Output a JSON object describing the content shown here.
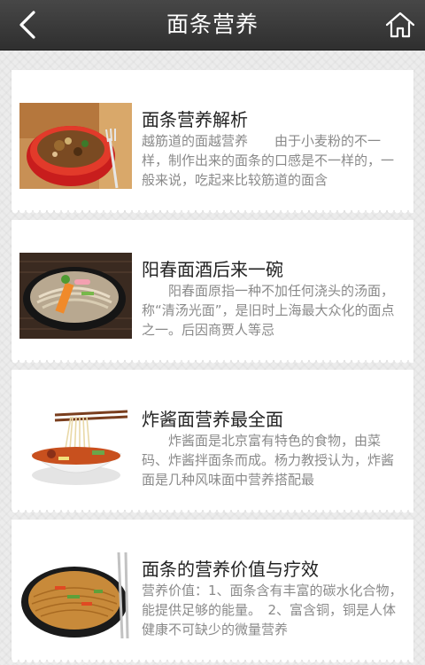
{
  "header": {
    "title": "面条营养",
    "back_icon": "chevron-left-icon",
    "home_icon": "home-icon",
    "background": "#3a3a3a"
  },
  "articles": [
    {
      "title": "面条营养解析",
      "summary": "越筋道的面越营养　　由于小麦粉的不一样，制作出来的面条的口感是不一样的，一般来说，吃起来比较筋道的面含",
      "thumbnail": "noodle-soup-bowl-with-fork"
    },
    {
      "title": "阳春面酒后来一碗",
      "summary": "　　阳春面原指一种不加任何浇头的汤面，称“清汤光面”，是旧时上海最大众化的面点之一。后因商贾人等忌",
      "thumbnail": "soba-noodles-in-black-bowl"
    },
    {
      "title": "炸酱面营养最全面",
      "summary": "　　炸酱面是北京富有特色的食物，由菜码、炸酱拌面条而成。杨力教授认为，炸酱面是几种风味面中营养搭配最",
      "thumbnail": "noodles-lifted-with-chopsticks"
    },
    {
      "title": "面条的营养价值与疗效",
      "summary": "营养价值：1、面条含有丰富的碳水化合物，能提供足够的能量。　2、富含铜，铜是人体健康不可缺少的微量营养",
      "thumbnail": "fried-noodles-plate"
    }
  ]
}
